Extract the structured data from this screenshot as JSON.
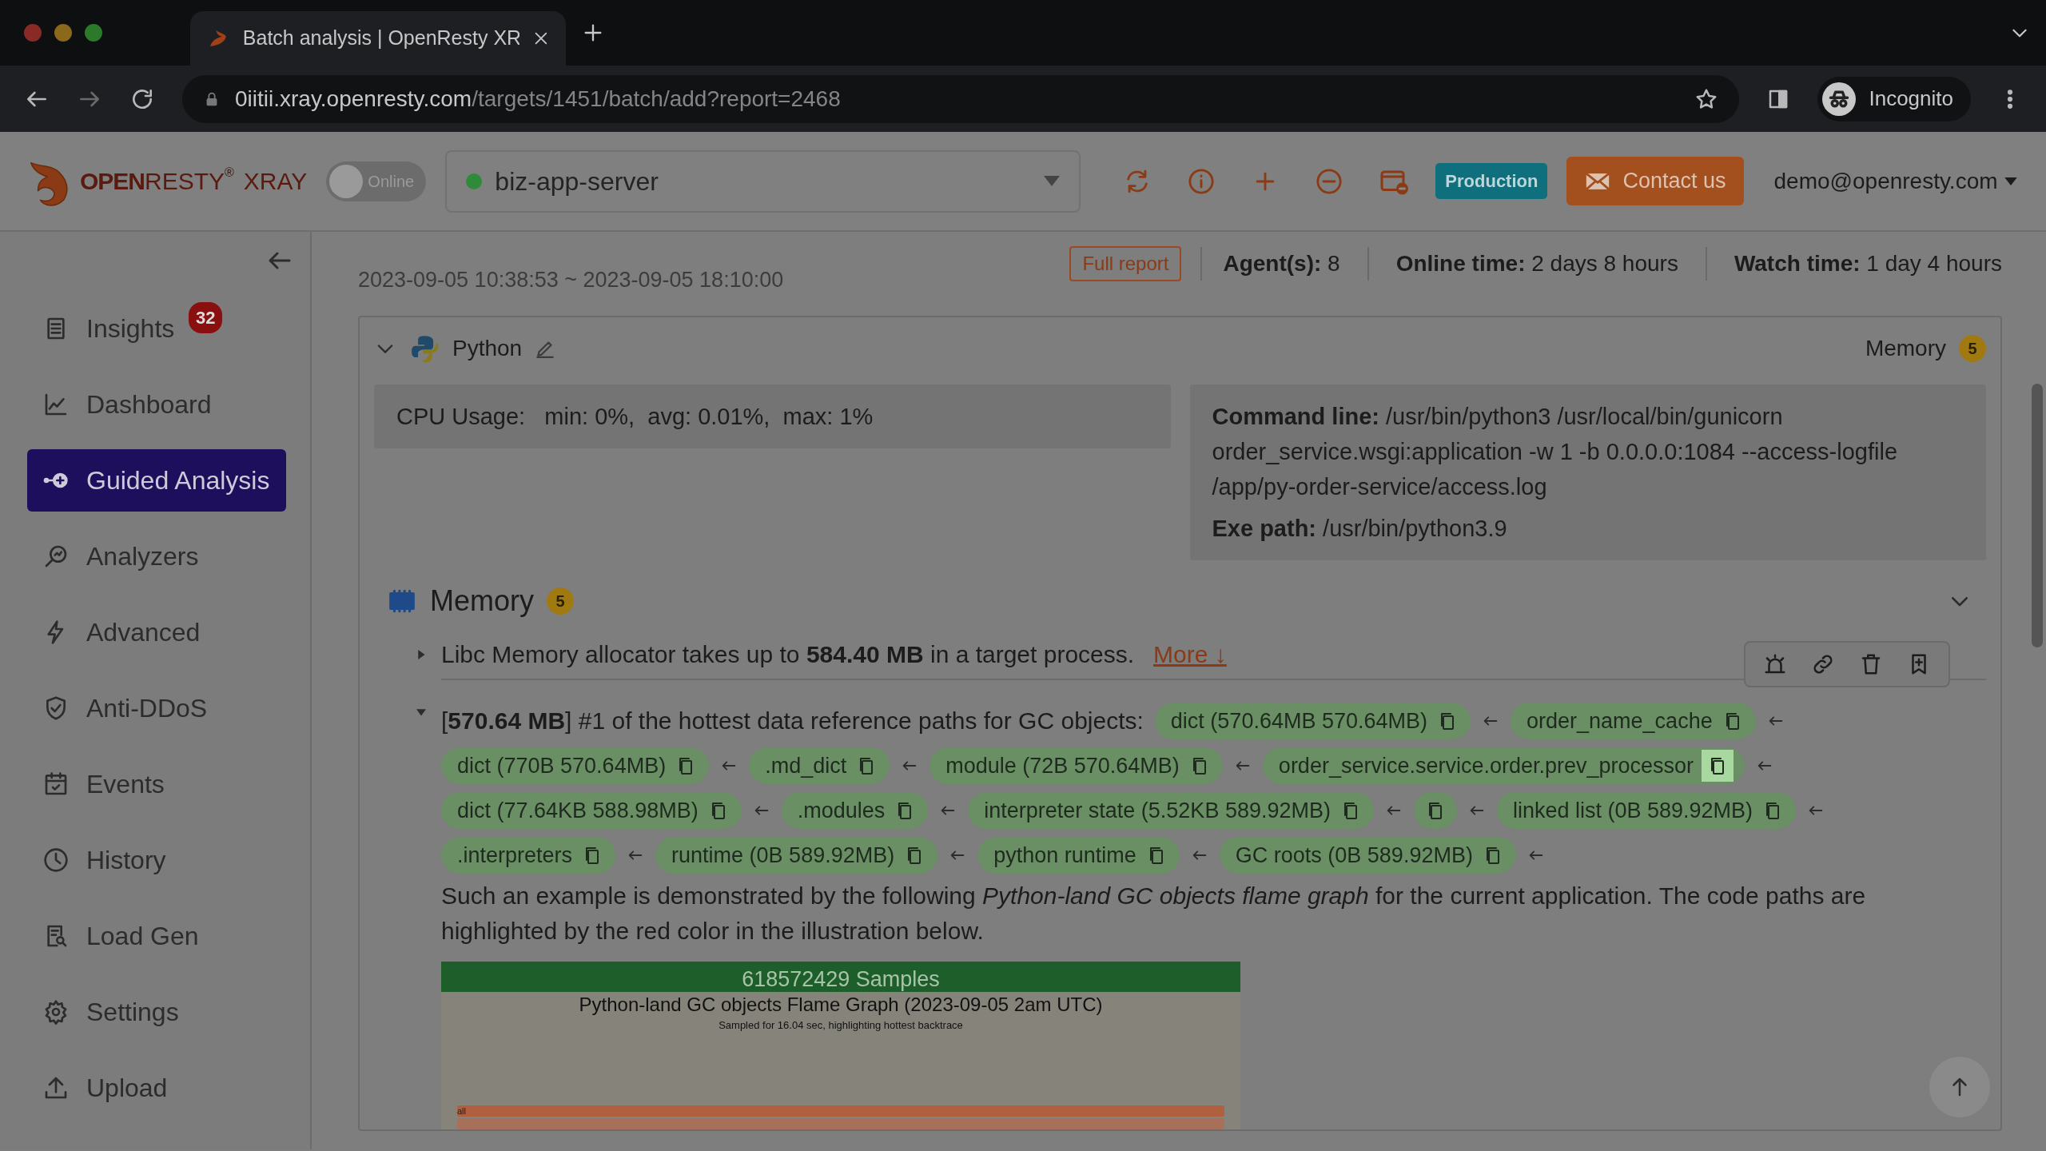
{
  "browser": {
    "tab_title": "Batch analysis | OpenResty XR",
    "url_host": "0iitii.xray.openresty.com",
    "url_path": "/targets/1451/batch/add?report=2468",
    "profile": "Incognito"
  },
  "header": {
    "logo_word_a": "OPEN",
    "logo_word_b": "RESTY",
    "logo_mark": "®",
    "product": "XRAY",
    "online_toggle": {
      "label": "Online",
      "on": false
    },
    "server": {
      "name": "biz-app-server",
      "color": "#2f8a3a"
    },
    "env_badge": "Production",
    "contact": "Contact us",
    "user": "demo@openresty.com"
  },
  "sidebar": {
    "items": [
      {
        "kind": "insights",
        "label": "Insights",
        "badge": "32",
        "selected": false
      },
      {
        "kind": "dashboard",
        "label": "Dashboard",
        "selected": false
      },
      {
        "kind": "guided",
        "label": "Guided Analysis",
        "selected": true
      },
      {
        "kind": "analyzers",
        "label": "Analyzers",
        "selected": false
      },
      {
        "kind": "advanced",
        "label": "Advanced",
        "selected": false
      },
      {
        "kind": "ddos",
        "label": "Anti-DDoS",
        "selected": false
      },
      {
        "kind": "events",
        "label": "Events",
        "selected": false
      },
      {
        "kind": "history",
        "label": "History",
        "selected": false
      },
      {
        "kind": "loadgen",
        "label": "Load Gen",
        "selected": false
      },
      {
        "kind": "settings",
        "label": "Settings",
        "selected": false
      },
      {
        "kind": "upload",
        "label": "Upload",
        "selected": false
      }
    ]
  },
  "report": {
    "time_range": "2023-09-05 10:38:53 ~ 2023-09-05 18:10:00",
    "full_report": "Full report",
    "stats": [
      {
        "label": "Agent(s):",
        "value": "8"
      },
      {
        "label": "Online time:",
        "value": "2 days 8 hours"
      },
      {
        "label": "Watch time:",
        "value": "1 day 4 hours"
      }
    ]
  },
  "process": {
    "name": "Python",
    "expanded": true,
    "summary_label": "Memory",
    "summary_count": "5",
    "cpu": {
      "label": "CPU Usage:",
      "value": "min: 0%,  avg: 0.01%,  max: 1%"
    },
    "command": {
      "label": "Command line:",
      "value": "/usr/bin/python3 /usr/local/bin/gunicorn order_service.wsgi:application -w 1 -b 0.0.0.0:1084 --access-logfile /app/py-order-service/access.log"
    },
    "exe": {
      "label": "Exe path:",
      "value": "/usr/bin/python3.9"
    }
  },
  "memory": {
    "title": "Memory",
    "count": "5",
    "expanded": true,
    "insights": [
      {
        "expanded": false,
        "text": "Libc Memory allocator takes up to **584.40 MB** in a target process.",
        "link": "More ↓"
      },
      {
        "expanded": true,
        "text": "[**570.64 MB**] #1 of the hottest data reference paths for GC objects:",
        "chips": [
          {
            "label": "dict (570.64MB 570.64MB)",
            "hovered": false
          },
          {
            "label": "order_name_cache",
            "hovered": false
          },
          {
            "label": "dict (770B 570.64MB)",
            "hovered": false
          },
          {
            "label": ".md_dict",
            "hovered": false
          },
          {
            "label": "module (72B 570.64MB)",
            "hovered": false
          },
          {
            "label": "order_service.service.order.prev_processor",
            "hovered": true
          },
          {
            "label": "dict (77.64KB 588.98MB)",
            "hovered": false
          },
          {
            "label": ".modules",
            "hovered": false
          },
          {
            "label": "interpreter state (5.52KB 589.92MB)",
            "hovered": false
          },
          {
            "hovered": false
          },
          {
            "label": "linked list (0B 589.92MB)",
            "hovered": false
          },
          {
            "label": ".interpreters",
            "hovered": false
          },
          {
            "label": "runtime (0B 589.92MB)",
            "hovered": false
          },
          {
            "label": "python runtime",
            "hovered": false
          },
          {
            "label": "GC roots (0B 589.92MB)",
            "hovered": false
          }
        ],
        "paragraph": "Such an example is demonstrated by the following *Python-land GC objects flame graph* for the current application. The code paths are highlighted by the red color in the illustration below.",
        "flame": {
          "samples": "618572429 Samples",
          "title": "Python-land GC objects Flame Graph (2023-09-05 2am UTC)",
          "subtitle": "Sampled for 16.04 sec, highlighting hottest backtrace",
          "root": "all"
        }
      }
    ]
  }
}
